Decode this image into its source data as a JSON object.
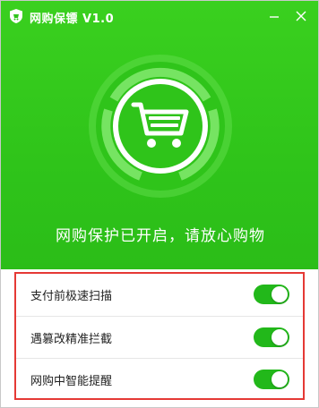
{
  "app": {
    "title": "网购保镖 V1.0"
  },
  "window_controls": {
    "minimize_icon": "minimize-icon",
    "close_icon": "close-icon"
  },
  "hero": {
    "icon": "shopping-cart-icon",
    "status": "网购保护已开启，请放心购物"
  },
  "options": [
    {
      "label": "支付前极速扫描",
      "enabled": true
    },
    {
      "label": "遇篡改精准拦截",
      "enabled": true
    },
    {
      "label": "网购中智能提醒",
      "enabled": true
    }
  ],
  "colors": {
    "brand_green": "#2fc41a",
    "toggle_on": "#22b81a",
    "highlight_border": "#e53935"
  }
}
